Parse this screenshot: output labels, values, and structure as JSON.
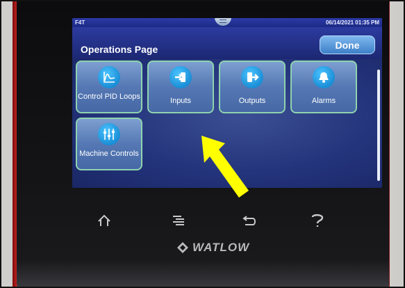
{
  "status": {
    "model": "F4T",
    "datetime": "06/14/2021 01:35 PM"
  },
  "header": {
    "title": "Operations Page",
    "done_label": "Done"
  },
  "tiles": [
    {
      "label": "Control PID Loops",
      "icon": "pid-loop-chart-icon"
    },
    {
      "label": "Inputs",
      "icon": "input-arrow-icon"
    },
    {
      "label": "Outputs",
      "icon": "output-arrow-icon"
    },
    {
      "label": "Alarms",
      "icon": "bell-icon"
    },
    {
      "label": "Machine Controls",
      "icon": "sliders-icon"
    }
  ],
  "hardware_buttons": [
    "home-icon",
    "menu-icon",
    "back-icon",
    "help-icon"
  ],
  "brand": {
    "name": "WATLOW"
  },
  "annotation": {
    "arrow_color": "#ffff00"
  },
  "colors": {
    "screen_bg": "#1f2d77",
    "tile_border": "#8fd3ae",
    "done_button": "#5a9be0",
    "bezel": "#111113"
  }
}
